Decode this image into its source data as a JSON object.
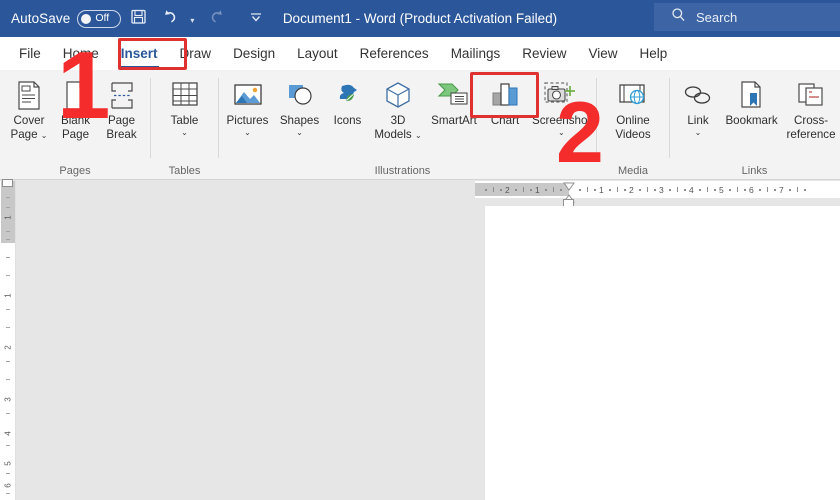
{
  "titlebar": {
    "autosave_label": "AutoSave",
    "autosave_state": "Off",
    "save_icon": "save-icon",
    "undo_icon": "undo-icon",
    "redo_icon": "redo-icon",
    "customize_icon": "customize-qat-icon",
    "document_title": "Document1  -  Word (Product Activation Failed)",
    "search_placeholder": "Search",
    "search_icon": "search-icon",
    "background_color": "#2b579a",
    "search_background_color": "#3d65a5"
  },
  "tabs": [
    {
      "label": "File",
      "active": false
    },
    {
      "label": "Home",
      "active": false
    },
    {
      "label": "Insert",
      "active": true
    },
    {
      "label": "Draw",
      "active": false
    },
    {
      "label": "Design",
      "active": false
    },
    {
      "label": "Layout",
      "active": false
    },
    {
      "label": "References",
      "active": false
    },
    {
      "label": "Mailings",
      "active": false
    },
    {
      "label": "Review",
      "active": false
    },
    {
      "label": "View",
      "active": false
    },
    {
      "label": "Help",
      "active": false
    }
  ],
  "ribbon": {
    "groups": [
      {
        "label": "Pages",
        "items": [
          {
            "label": "Cover",
            "label2": "Page",
            "icon": "cover-page-icon",
            "dropdown": true
          },
          {
            "label": "Blank",
            "label2": "Page",
            "icon": "blank-page-icon",
            "dropdown": false
          },
          {
            "label": "Page",
            "label2": "Break",
            "icon": "page-break-icon",
            "dropdown": false
          }
        ]
      },
      {
        "label": "Tables",
        "items": [
          {
            "label": "Table",
            "label2": "",
            "icon": "table-icon",
            "dropdown": true
          }
        ]
      },
      {
        "label": "Illustrations",
        "items": [
          {
            "label": "Pictures",
            "label2": "",
            "icon": "pictures-icon",
            "dropdown": true
          },
          {
            "label": "Shapes",
            "label2": "",
            "icon": "shapes-icon",
            "dropdown": true
          },
          {
            "label": "Icons",
            "label2": "",
            "icon": "icons-icon",
            "dropdown": false
          },
          {
            "label": "3D",
            "label2": "Models",
            "icon": "3d-models-icon",
            "dropdown": true
          },
          {
            "label": "SmartArt",
            "label2": "",
            "icon": "smartart-icon",
            "dropdown": false
          },
          {
            "label": "Chart",
            "label2": "",
            "icon": "chart-icon",
            "dropdown": false
          },
          {
            "label": "Screenshot",
            "label2": "",
            "icon": "screenshot-icon",
            "dropdown": true
          }
        ]
      },
      {
        "label": "Media",
        "items": [
          {
            "label": "Online",
            "label2": "Videos",
            "icon": "online-videos-icon",
            "dropdown": false
          }
        ]
      },
      {
        "label": "Links",
        "items": [
          {
            "label": "Link",
            "label2": "",
            "icon": "link-icon",
            "dropdown": true
          },
          {
            "label": "Bookmark",
            "label2": "",
            "icon": "bookmark-icon",
            "dropdown": false
          },
          {
            "label": "Cross-",
            "label2": "reference",
            "icon": "cross-reference-icon",
            "dropdown": false
          }
        ]
      }
    ]
  },
  "annotations": {
    "color": "#e03131",
    "number_color": "#f42c2c",
    "step1": "1",
    "step2": "2",
    "highlight_insert_tab": "Insert",
    "highlight_chart_button": "Chart"
  },
  "document": {
    "horizontal_ruler_marks": [
      "2",
      "1",
      "1",
      "2",
      "3",
      "4",
      "5",
      "6",
      "7"
    ],
    "vertical_ruler_marks": [
      "1",
      "1",
      "2",
      "3",
      "4",
      "5",
      "6"
    ],
    "page_background": "#ffffff",
    "workspace_background": "#e6e6e6"
  }
}
